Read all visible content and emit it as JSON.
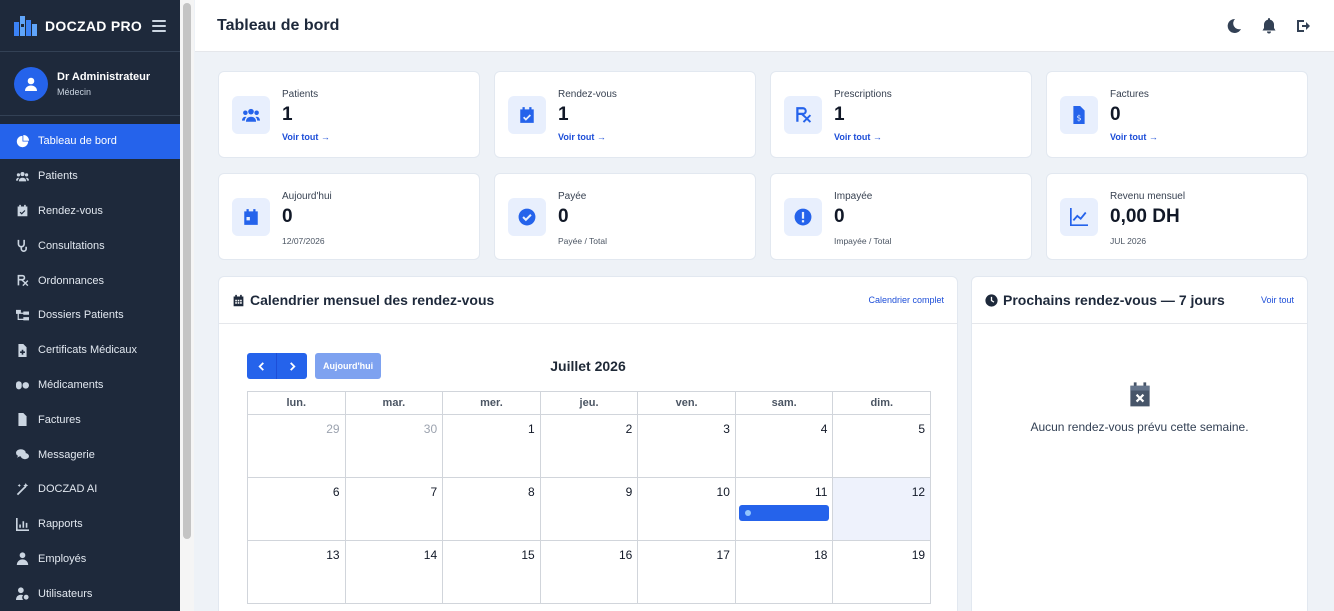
{
  "brand": {
    "name": "DOCZAD PRO"
  },
  "user": {
    "name": "Dr Administrateur",
    "role": "Médecin"
  },
  "sidebar": {
    "items": [
      {
        "label": "Tableau de bord",
        "icon": "dashboard-icon",
        "active": true
      },
      {
        "label": "Patients",
        "icon": "users-icon"
      },
      {
        "label": "Rendez-vous",
        "icon": "calendar-check-icon"
      },
      {
        "label": "Consultations",
        "icon": "stethoscope-icon"
      },
      {
        "label": "Ordonnances",
        "icon": "prescription-icon"
      },
      {
        "label": "Dossiers Patients",
        "icon": "folder-tree-icon"
      },
      {
        "label": "Certificats Médicaux",
        "icon": "file-medical-icon"
      },
      {
        "label": "Médicaments",
        "icon": "pills-icon"
      },
      {
        "label": "Factures",
        "icon": "invoice-icon"
      },
      {
        "label": "Messagerie",
        "icon": "comments-icon"
      },
      {
        "label": "DOCZAD AI",
        "icon": "magic-wand-icon"
      },
      {
        "label": "Rapports",
        "icon": "chart-icon"
      },
      {
        "label": "Employés",
        "icon": "user-tie-icon"
      },
      {
        "label": "Utilisateurs",
        "icon": "user-gear-icon"
      }
    ]
  },
  "header": {
    "title": "Tableau de bord"
  },
  "stats_top": [
    {
      "label": "Patients",
      "value": "1",
      "link": "Voir tout →",
      "icon": "users-icon"
    },
    {
      "label": "Rendez-vous",
      "value": "1",
      "link": "Voir tout →",
      "icon": "calendar-check-icon"
    },
    {
      "label": "Prescriptions",
      "value": "1",
      "link": "Voir tout →",
      "icon": "prescription-icon"
    },
    {
      "label": "Factures",
      "value": "0",
      "link": "Voir tout →",
      "icon": "invoice-icon"
    }
  ],
  "stats_bottom": [
    {
      "label": "Aujourd'hui",
      "value": "0",
      "sub": "12/07/2026",
      "icon": "calendar-day-icon"
    },
    {
      "label": "Payée",
      "value": "0",
      "sub": "Payée / Total",
      "icon": "check-circle-icon"
    },
    {
      "label": "Impayée",
      "value": "0",
      "sub": "Impayée / Total",
      "icon": "exclamation-circle-icon"
    },
    {
      "label": "Revenu mensuel",
      "value": "0,00 DH",
      "sub": "JUL 2026",
      "icon": "chart-line-icon"
    }
  ],
  "calendar": {
    "title": "Calendrier mensuel des rendez-vous",
    "link": "Calendrier complet",
    "today_button": "Aujourd'hui",
    "month": "Juillet 2026",
    "days": [
      "lun.",
      "mar.",
      "mer.",
      "jeu.",
      "ven.",
      "sam.",
      "dim."
    ],
    "weeks": [
      [
        "29",
        "30",
        "1",
        "2",
        "3",
        "4",
        "5"
      ],
      [
        "6",
        "7",
        "8",
        "9",
        "10",
        "11",
        "12"
      ],
      [
        "13",
        "14",
        "15",
        "16",
        "17",
        "18",
        "19"
      ]
    ]
  },
  "upcoming": {
    "title": "Prochains rendez-vous — 7 jours",
    "link": "Voir tout",
    "empty": "Aucun rendez-vous prévu cette semaine."
  },
  "colors": {
    "primary": "#2563eb",
    "sidebar": "#1e293b",
    "background": "#eef2f7"
  }
}
